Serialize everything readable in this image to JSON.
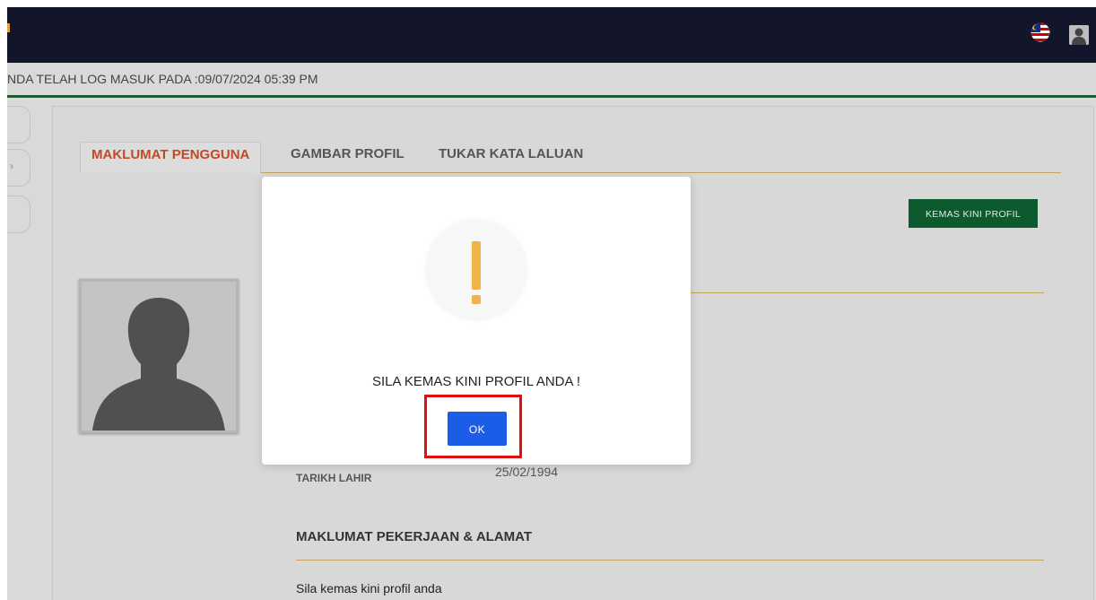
{
  "header": {
    "login_text": "NDA TELAH LOG MASUK PADA :09/07/2024 05:39 PM",
    "language_icon": "malaysia-flag-icon",
    "user_icon": "user-avatar-icon"
  },
  "tabs": [
    {
      "label": "MAKLUMAT PENGGUNA",
      "active": true
    },
    {
      "label": "GAMBAR PROFIL",
      "active": false
    },
    {
      "label": "TUKAR KATA LALUAN",
      "active": false
    }
  ],
  "profile": {
    "update_button_label": "KEMAS KINI PROFIL",
    "dob_label": "TARIKH LAHIR",
    "dob_value": "25/02/1994",
    "work_section_heading": "MAKLUMAT PEKERJAAN & ALAMAT",
    "work_section_placeholder": "Sila kemas kini profil anda"
  },
  "modal": {
    "icon": "warning-exclamation-icon",
    "message": "SILA KEMAS KINI PROFIL ANDA !",
    "ok_label": "OK"
  },
  "colors": {
    "topbar": "#13162a",
    "active_tab": "#c14a24",
    "update_button": "#0d5a2f",
    "ok_button": "#1c5de8",
    "warning": "#f2b24b",
    "highlight": "#e01010"
  }
}
